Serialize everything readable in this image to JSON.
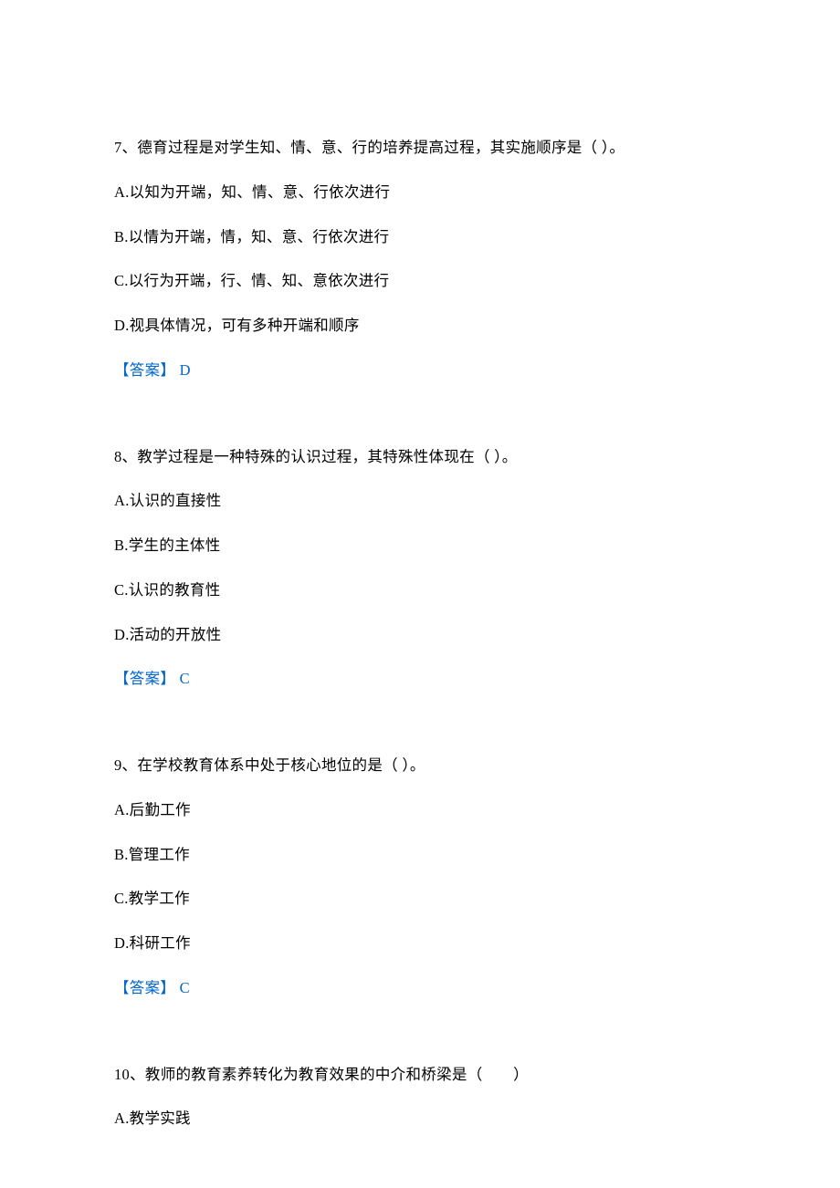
{
  "questions": [
    {
      "number": "7、",
      "stem": "德育过程是对学生知、情、意、行的培养提高过程，其实施顺序是（ ）。",
      "options": {
        "a": "A.以知为开端，知、情、意、行依次进行",
        "b": "B.以情为开端，情，知、意、行依次进行",
        "c": "C.以行为开端，行、情、知、意依次进行",
        "d": "D.视具体情况，可有多种开端和顺序"
      },
      "answer_label": "【答案】 D"
    },
    {
      "number": "8、",
      "stem": "教学过程是一种特殊的认识过程，其特殊性体现在（ ）。",
      "options": {
        "a": "A.认识的直接性",
        "b": "B.学生的主体性",
        "c": "C.认识的教育性",
        "d": "D.活动的开放性"
      },
      "answer_label": "【答案】 C"
    },
    {
      "number": "9、",
      "stem": "在学校教育体系中处于核心地位的是（ ）。",
      "options": {
        "a": "A.后勤工作",
        "b": "B.管理工作",
        "c": "C.教学工作",
        "d": "D.科研工作"
      },
      "answer_label": "【答案】 C"
    },
    {
      "number": "10、",
      "stem": "教师的教育素养转化为教育效果的中介和桥梁是（　　）",
      "options": {
        "a": "A.教学实践"
      }
    }
  ]
}
